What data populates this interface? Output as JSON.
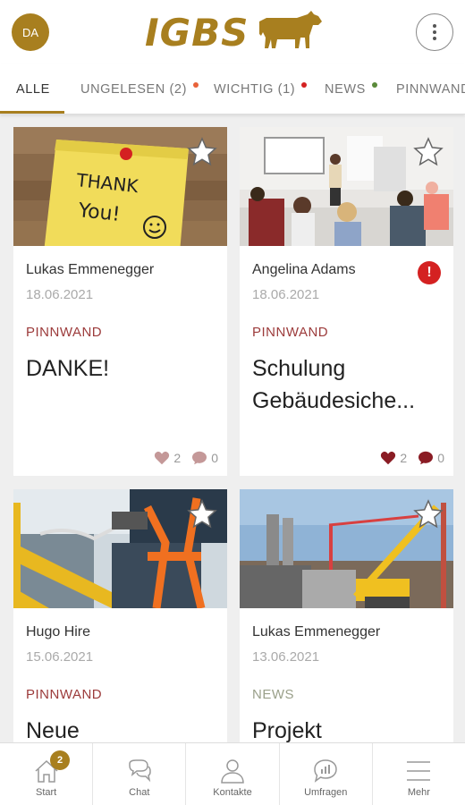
{
  "header": {
    "avatar_initials": "DA",
    "logo_text": "IGBS",
    "brand_color": "#a87f1f"
  },
  "tabs": [
    {
      "label": "ALLE",
      "active": true
    },
    {
      "label": "UNGELESEN (2)",
      "dot_color": "#e8623a"
    },
    {
      "label": "WICHTIG (1)",
      "dot_color": "#d42121"
    },
    {
      "label": "NEWS",
      "dot_color": "#5a8a3a"
    },
    {
      "label": "PINNWAND"
    }
  ],
  "cards": [
    {
      "author": "Lukas Emmenegger",
      "date": "18.06.2021",
      "category": "PINNWAND",
      "title_lines": [
        "DANKE!"
      ],
      "likes": "2",
      "comments": "0",
      "liked": false,
      "important": false,
      "image_text": [
        "THANK",
        "You!"
      ]
    },
    {
      "author": "Angelina Adams",
      "date": "18.06.2021",
      "category": "PINNWAND",
      "title_lines": [
        "Schulung",
        "Gebäudesiche..."
      ],
      "likes": "2",
      "comments": "0",
      "liked": true,
      "important": true,
      "important_mark": "!"
    },
    {
      "author": "Hugo Hire",
      "date": "15.06.2021",
      "category": "PINNWAND",
      "title_lines": [
        "Neue"
      ]
    },
    {
      "author": "Lukas Emmenegger",
      "date": "13.06.2021",
      "category": "NEWS",
      "title_lines": [
        "Projekt"
      ]
    }
  ],
  "bottom_nav": [
    {
      "label": "Start",
      "icon": "home-icon",
      "badge": "2"
    },
    {
      "label": "Chat",
      "icon": "chat-icon"
    },
    {
      "label": "Kontakte",
      "icon": "person-icon"
    },
    {
      "label": "Umfragen",
      "icon": "poll-icon"
    },
    {
      "label": "Mehr",
      "icon": "menu-icon"
    }
  ]
}
